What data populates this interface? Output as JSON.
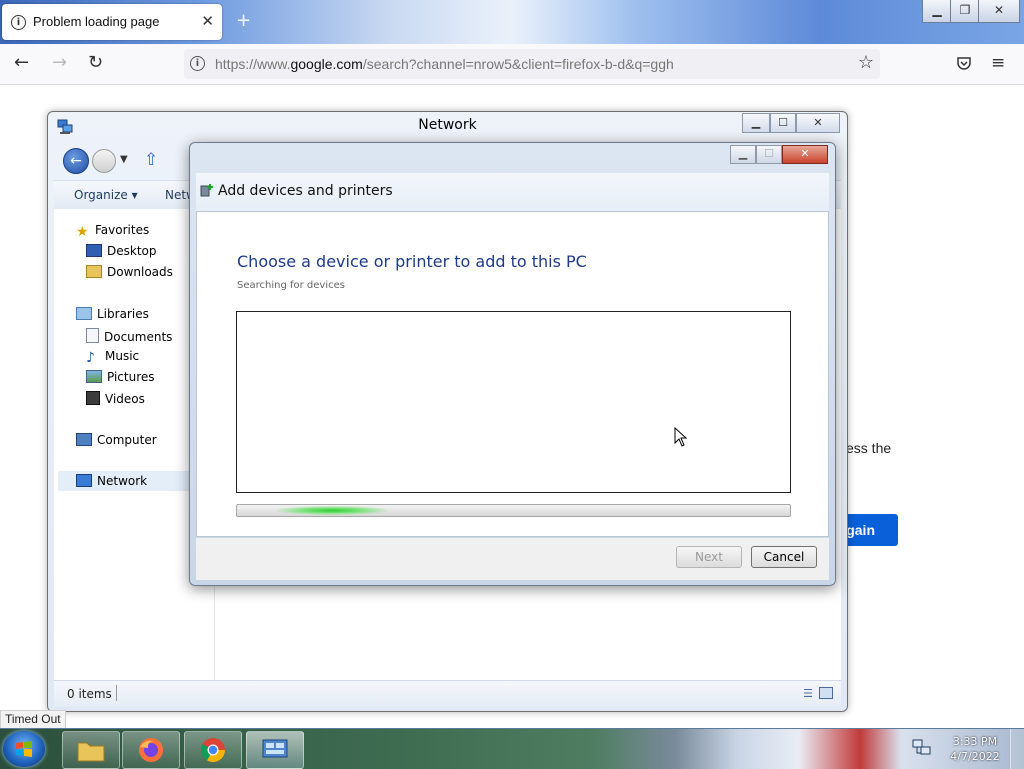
{
  "browser": {
    "tab_title": "Problem loading page",
    "tab_close": "✕",
    "new_tab": "+",
    "url_prefix": "https://www.",
    "url_domain": "google.com",
    "url_rest": "/search?channel=nrow5&client=firefox-b-d&q=ggh",
    "page_fragment": "ess the",
    "try_again_fragment": "gain",
    "status_tooltip": "Timed Out"
  },
  "explorer": {
    "title": "Network",
    "toolbar": {
      "organize": "Organize ▾",
      "network": "Netw"
    },
    "nav": {
      "favorites": "Favorites",
      "desktop": "Desktop",
      "downloads": "Downloads",
      "libraries": "Libraries",
      "documents": "Documents",
      "music": "Music",
      "pictures": "Pictures",
      "videos": "Videos",
      "computer": "Computer",
      "network": "Network"
    },
    "status": "0 items"
  },
  "dialog": {
    "title": "Add devices and printers",
    "heading": "Choose a device or printer to add to this PC",
    "subtext": "Searching for devices",
    "next_label": "Next",
    "cancel_label": "Cancel"
  },
  "taskbar": {
    "time": "3:33 PM",
    "date": "4/7/2022"
  },
  "colors": {
    "link_blue": "#1e3a8a",
    "firefox_button": "#0a60d8",
    "progress_green": "#2ecf2e"
  }
}
